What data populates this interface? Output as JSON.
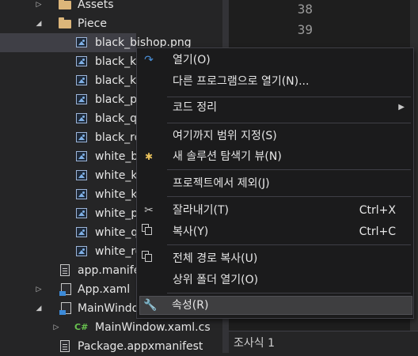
{
  "tree": {
    "items": [
      {
        "label": "Assets",
        "icon": "folder-icon",
        "arrow": "collapsed"
      },
      {
        "label": "Piece",
        "icon": "folder-icon",
        "arrow": "expanded"
      },
      {
        "label": "black_bishop.png",
        "icon": "image-file-icon",
        "selected": true
      },
      {
        "label": "black_ki",
        "icon": "image-file-icon"
      },
      {
        "label": "black_kn",
        "icon": "image-file-icon"
      },
      {
        "label": "black_pa",
        "icon": "image-file-icon"
      },
      {
        "label": "black_qu",
        "icon": "image-file-icon"
      },
      {
        "label": "black_ro",
        "icon": "image-file-icon"
      },
      {
        "label": "white_bi",
        "icon": "image-file-icon"
      },
      {
        "label": "white_ki",
        "icon": "image-file-icon"
      },
      {
        "label": "white_kn",
        "icon": "image-file-icon"
      },
      {
        "label": "white_pa",
        "icon": "image-file-icon"
      },
      {
        "label": "white_qu",
        "icon": "image-file-icon"
      },
      {
        "label": "white_ro",
        "icon": "image-file-icon"
      },
      {
        "label": "app.manife",
        "icon": "manifest-file-icon"
      },
      {
        "label": "App.xaml",
        "icon": "xaml-file-icon",
        "arrow": "collapsed"
      },
      {
        "label": "MainWindo",
        "icon": "xaml-file-icon",
        "arrow": "expanded"
      },
      {
        "label": "MainWindow.xaml.cs",
        "icon": "csharp-file-icon",
        "arrow": "collapsed"
      },
      {
        "label": "Package.appxmanifest",
        "icon": "manifest-file-icon"
      }
    ]
  },
  "editor": {
    "line_numbers": [
      "38",
      "39"
    ]
  },
  "bottom_pane": {
    "label": "조사식 1"
  },
  "context_menu": {
    "open": {
      "label": "열기(O)",
      "icon": "open-arrow-icon"
    },
    "open_with": {
      "label": "다른 프로그램으로 열기(N)..."
    },
    "code_cleanup": {
      "label": "코드 정리",
      "submenu": "▶"
    },
    "scope_to_this": {
      "label": "여기까지 범위 지정(S)"
    },
    "new_explorer_view": {
      "label": "새 솔루션 탐색기 뷰(N)",
      "icon": "new-explorer-view-icon"
    },
    "exclude_from_project": {
      "label": "프로젝트에서 제외(J)"
    },
    "cut": {
      "label": "잘라내기(T)",
      "shortcut": "Ctrl+X",
      "icon": "scissors-icon"
    },
    "copy": {
      "label": "복사(Y)",
      "shortcut": "Ctrl+C",
      "icon": "copy-icon"
    },
    "copy_full_path": {
      "label": "전체 경로 복사(U)",
      "icon": "copy-icon"
    },
    "open_containing_folder": {
      "label": "상위 폴더 열기(O)"
    },
    "properties": {
      "label": "속성(R)",
      "icon": "wrench-icon",
      "highlighted": true
    }
  },
  "colors": {
    "background": "#252526",
    "editor_background": "#1e1e1e",
    "menu_background": "#1b1b1c",
    "selection": "#3f3f46",
    "folder": "#dcb67a",
    "csharp": "#68c34f",
    "accent_blue": "#3c8ad8"
  }
}
